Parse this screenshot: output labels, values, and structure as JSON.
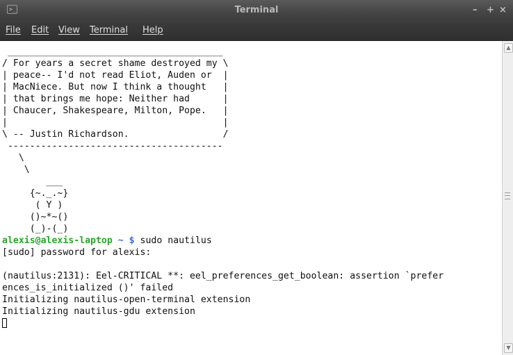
{
  "window": {
    "title": "Terminal",
    "controls": {
      "minimize": "–",
      "maximize": "+",
      "close": "×"
    }
  },
  "menu": [
    {
      "label": "File"
    },
    {
      "label": "Edit"
    },
    {
      "label": "View"
    },
    {
      "label": "Terminal"
    },
    {
      "label": "Help"
    }
  ],
  "terminal": {
    "fortune_block": " _______________________________________\n/ For years a secret shame destroyed my \\\n| peace-- I'd not read Eliot, Auden or  |\n| MacNiece. But now I think a thought   |\n| that brings me hope: Neither had      |\n| Chaucer, Shakespeare, Milton, Pope.   |\n|                                       |\n\\ -- Justin Richardson.                 /\n ---------------------------------------\n   \\\n    \\\n        ___\n     {~._.~}\n      ( Y )\n     ()~*~()\n     (_)-(_)",
    "prompt": {
      "user_host": "alexis@alexis-laptop",
      "dir": "~",
      "symbol": "$",
      "command": " sudo nautilus"
    },
    "output": "[sudo] password for alexis:\n\n(nautilus:2131): Eel-CRITICAL **: eel_preferences_get_boolean: assertion `prefer\nences_is_initialized ()' failed\nInitializing nautilus-open-terminal extension\nInitializing nautilus-gdu extension"
  },
  "icons": {
    "app": "terminal-icon",
    "scroll_up": "arrow-up-icon",
    "scroll_down": "arrow-down-icon"
  }
}
